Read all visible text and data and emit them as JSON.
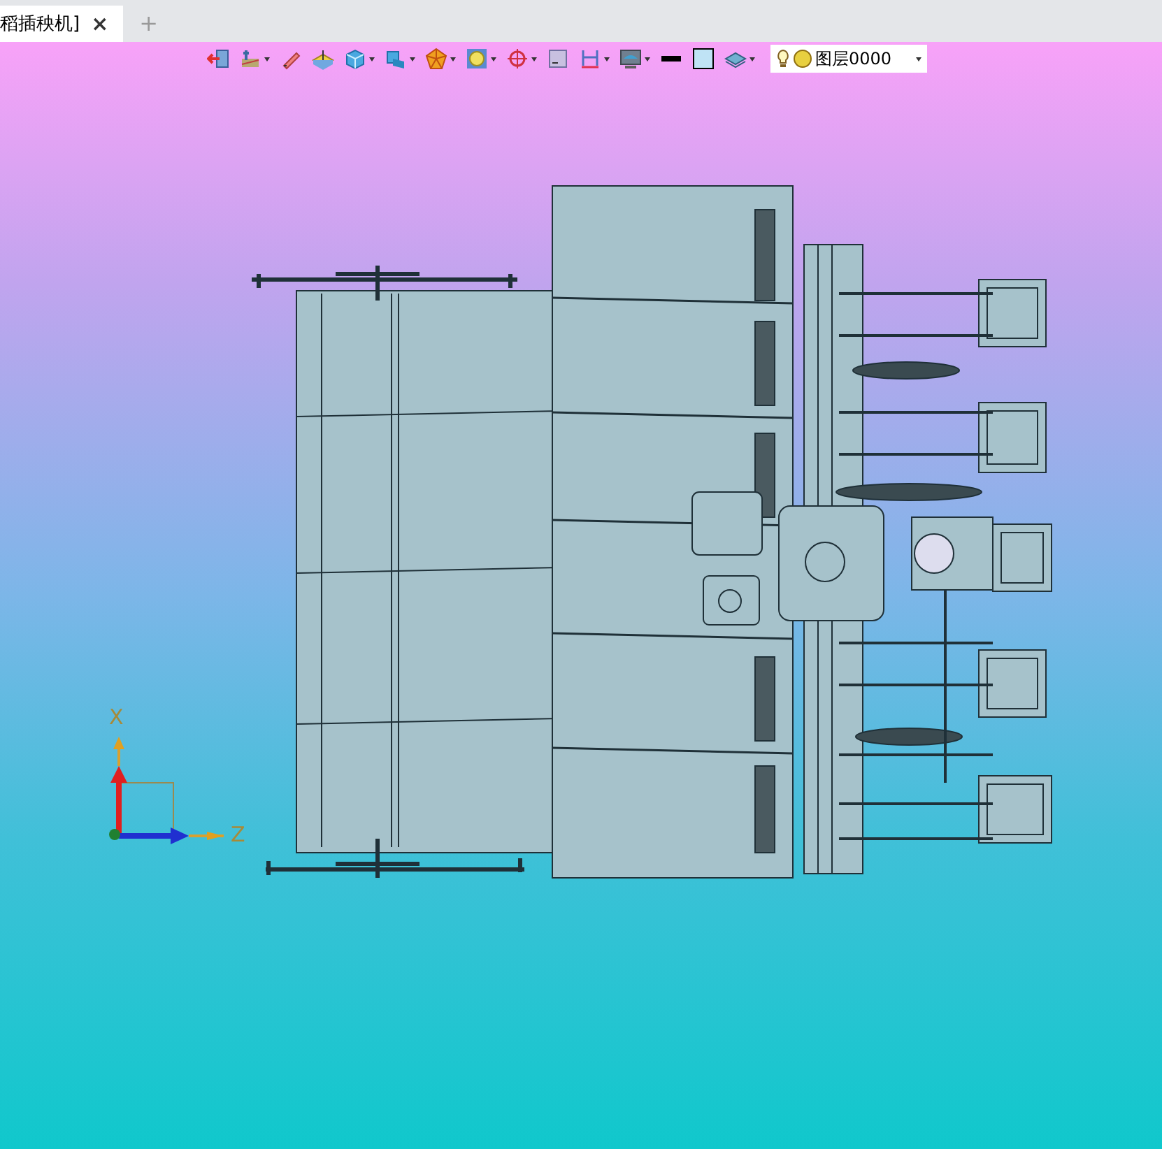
{
  "tabs": [
    {
      "label": "稻插秧机]",
      "selected": true,
      "close": "×"
    }
  ],
  "new_tab": "+",
  "toolbar": [
    {
      "kind": "exit",
      "dropdown": false
    },
    {
      "kind": "sketch",
      "dropdown": true
    },
    {
      "kind": "pen",
      "dropdown": false
    },
    {
      "kind": "plane",
      "dropdown": false
    },
    {
      "kind": "box",
      "dropdown": true
    },
    {
      "kind": "cube",
      "dropdown": true
    },
    {
      "kind": "polygon",
      "dropdown": true
    },
    {
      "kind": "frame",
      "dropdown": true
    },
    {
      "kind": "target",
      "dropdown": true
    },
    {
      "kind": "panel",
      "dropdown": false
    },
    {
      "kind": "h",
      "dropdown": true
    },
    {
      "kind": "monitor",
      "dropdown": true
    },
    {
      "kind": "line",
      "dropdown": false
    },
    {
      "kind": "fill",
      "dropdown": false
    },
    {
      "kind": "layers",
      "dropdown": true
    }
  ],
  "layer_selector": {
    "value": "图层0000"
  },
  "axes": {
    "x_label": "X",
    "z_label": "Z"
  }
}
